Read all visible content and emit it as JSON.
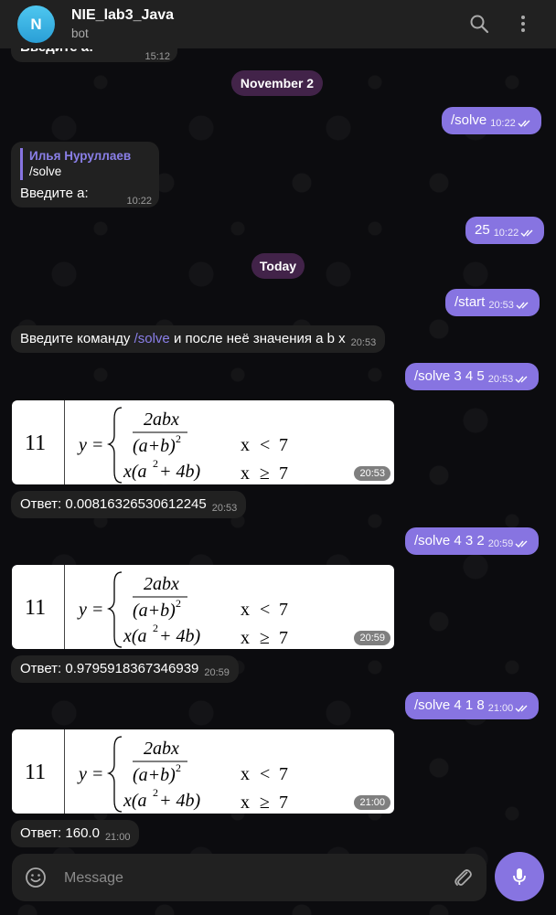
{
  "header": {
    "avatar_letter": "N",
    "title": "NIE_lab3_Java",
    "subtitle": "bot"
  },
  "messages": {
    "top_partial": {
      "text": "Введите a:",
      "time": "15:12"
    },
    "date1": "November 2",
    "m1": {
      "text": "/solve",
      "time": "10:22"
    },
    "m2": {
      "reply_name": "Илья Нуруллаев",
      "reply_text": "/solve",
      "text": "Введите a:",
      "time": "10:22"
    },
    "m3": {
      "text": "25",
      "time": "10:22"
    },
    "date2": "Today",
    "m4": {
      "text": "/start",
      "time": "20:53"
    },
    "m5": {
      "text_before": "Введите команду ",
      "command": "/solve",
      "text_after": " и после неё значения a b x",
      "time": "20:53"
    },
    "m6": {
      "text": "/solve 3 4 5",
      "time": "20:53"
    },
    "img1": {
      "number": "11",
      "time": "20:53"
    },
    "m7": {
      "text": "Ответ: 0.00816326530612245",
      "time": "20:53"
    },
    "m8": {
      "text": "/solve 4 3 2",
      "time": "20:59"
    },
    "img2": {
      "number": "11",
      "time": "20:59"
    },
    "m9": {
      "text": "Ответ: 0.9795918367346939",
      "time": "20:59"
    },
    "m10": {
      "text": "/solve 4 1 8",
      "time": "21:00"
    },
    "img3": {
      "number": "11",
      "time": "21:00"
    },
    "m11": {
      "text": "Ответ: 160.0",
      "time": "21:00"
    }
  },
  "formula": {
    "lhs": "y =",
    "numerator": "2abx",
    "denominator": "(a+b)",
    "denominator_exp": "2",
    "second_case": "x(a",
    "second_case_exp": "2",
    "second_case_rest": " + 4b)",
    "cond1_var": "x",
    "cond1_op": "<",
    "cond1_val": "7",
    "cond2_var": "x",
    "cond2_op": "≥",
    "cond2_val": "7"
  },
  "composer": {
    "placeholder": "Message"
  },
  "colors": {
    "accent": "#8774e1",
    "incoming_bubble": "#212121",
    "header": "#212121",
    "date_pill": "#48264e"
  },
  "icons": [
    "search-icon",
    "more-vertical-icon",
    "emoji-icon",
    "attach-icon",
    "mic-icon",
    "double-check-icon"
  ]
}
